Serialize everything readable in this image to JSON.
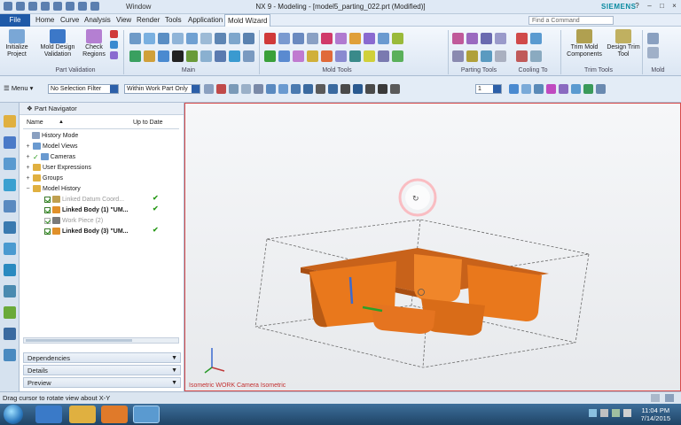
{
  "window": {
    "menu_title": "Window",
    "title": "NX 9 - Modeling - [model5_parting_022.prt (Modified)]",
    "brand": "SIEMENS",
    "controls": [
      "?",
      "–",
      "□",
      "×"
    ]
  },
  "menubar": {
    "file": "File",
    "items": [
      "Home",
      "Curve",
      "Analysis",
      "View",
      "Render",
      "Tools",
      "Application",
      "Mold Wizard"
    ],
    "active_index": 7,
    "find_placeholder": "Find a Command"
  },
  "ribbon": {
    "initialize": "Initialize Project",
    "mold_design_validation": "Mold Design Validation",
    "check_regions": "Check Regions",
    "trim_mold_components": "Trim Mold Components",
    "design_trim_tool": "Design Trim Tool",
    "groups": [
      "Part Validation",
      "Main",
      "Mold Tools",
      "Parting Tools",
      "Cooling To",
      "Trim Tools",
      "Mold"
    ]
  },
  "toolbar2": {
    "menu": "Menu",
    "selection_filter": "No Selection Filter",
    "scope": "Within Work Part Only",
    "layer": "1"
  },
  "navigator": {
    "title": "Part Navigator",
    "col_name": "Name",
    "col_uptodate": "Up to Date",
    "items": [
      {
        "label": "History Mode"
      },
      {
        "label": "Model Views"
      },
      {
        "label": "Cameras"
      },
      {
        "label": "User Expressions"
      },
      {
        "label": "Groups"
      },
      {
        "label": "Model History"
      },
      {
        "label": "Linked Datum Coord..."
      },
      {
        "label": "Linked Body (1) \"UM..."
      },
      {
        "label": "Work Piece (2)"
      },
      {
        "label": "Linked Body (3) \"UM..."
      }
    ],
    "sections": [
      "Dependencies",
      "Details",
      "Preview"
    ]
  },
  "viewport": {
    "caption": "Isometric WORK Camera Isometric"
  },
  "status": {
    "text": "Drag cursor to rotate view about X-Y"
  },
  "taskbar": {
    "time": "11:04 PM",
    "date": "7/14/2015"
  },
  "colors": {
    "part_orange": "#e9781c",
    "accent_blue": "#1f5aa8",
    "check_green": "#2a9a1a"
  }
}
